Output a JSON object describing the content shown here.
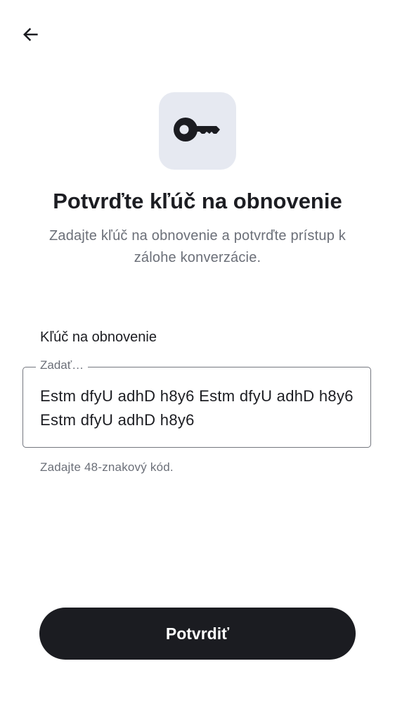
{
  "header": {
    "back_icon": "arrow-left-icon"
  },
  "hero": {
    "icon": "key-icon",
    "icon_background": "#e6e9f1",
    "title": "Potvrďte kľúč na obnovenie",
    "subtitle": "Zadajte kľúč na obnovenie a potvrďte prístup k zálohe konverzácie."
  },
  "recovery_key_field": {
    "label": "Kľúč na obnovenie",
    "placeholder": "Zadať…",
    "value": "Estm dfyU adhD h8y6 Estm dfyU adhD h8y6 Estm dfyU adhD h8y6",
    "helper_text": "Zadajte 48-znakový kód."
  },
  "actions": {
    "confirm_label": "Potvrdiť",
    "confirm_color": "#1b1c21"
  }
}
